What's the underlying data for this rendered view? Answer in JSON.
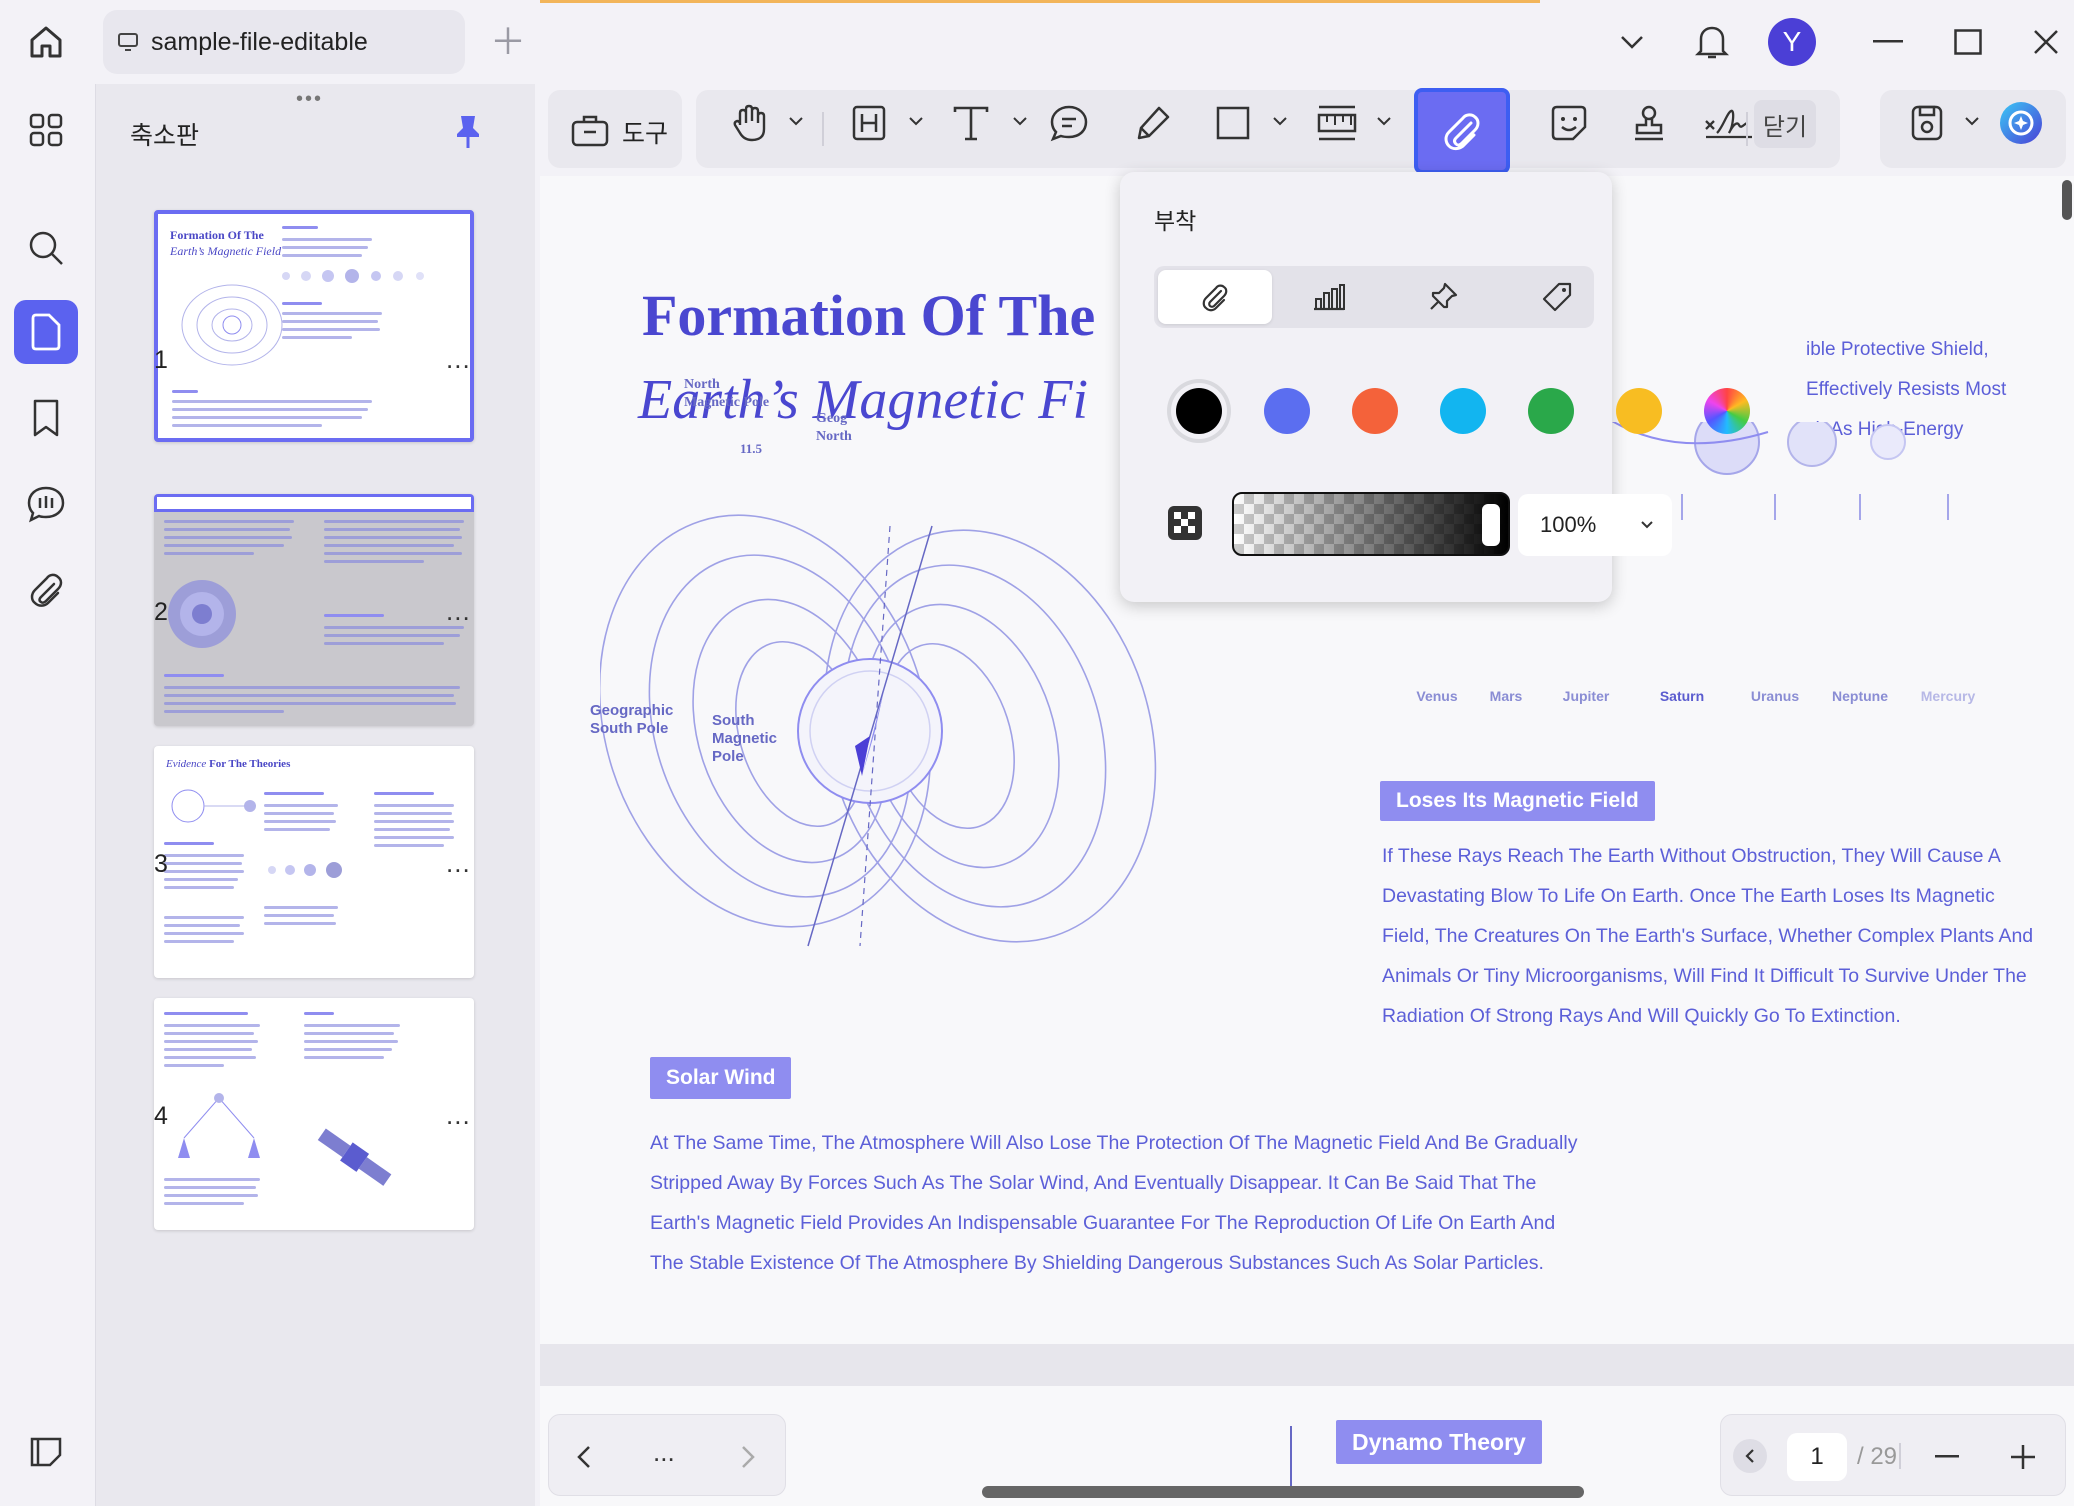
{
  "window": {
    "tab_title": "sample-file-editable",
    "avatar_letter": "Y",
    "accent_color": "#5b62ef"
  },
  "panel": {
    "title": "축소판",
    "pages": [
      {
        "number": "1",
        "more": "..."
      },
      {
        "number": "2",
        "more": "..."
      },
      {
        "number": "3",
        "more": "..."
      },
      {
        "number": "4",
        "more": "..."
      }
    ]
  },
  "toolbar": {
    "tools_label": "도구",
    "close_label": "닫기",
    "active_tool": "attachment"
  },
  "document": {
    "title_line1": "Formation Of The",
    "title_line2": "Earth’s Magnetic Fi",
    "right_lines": [
      "ible Protective Shield,",
      "Effectively Resists Most",
      "ch As High-Energy"
    ],
    "planets": [
      "Venus",
      "Mars",
      "Jupiter",
      "Saturn",
      "Uranus",
      "Neptune",
      "Mercury"
    ],
    "diagram": {
      "north_pole": "North\nMagnetic Pole",
      "geo_north": "Geog\nNorth",
      "angle": "11.5",
      "geo_south": "Geographic\nSouth Pole",
      "south_pole": "South\nMagnetic\nPole"
    },
    "section1_tag": "Loses Its Magnetic Field",
    "section1_lines": [
      "If These Rays Reach The Earth Without Obstruction, They Will Cause A",
      "Devastating Blow To Life On Earth. Once The Earth Loses Its Magnetic",
      "Field, The Creatures On The Earth's Surface, Whether Complex Plants And",
      "Animals Or Tiny Microorganisms, Will Find It Difficult To Survive Under The",
      "Radiation Of Strong Rays And Will Quickly Go To Extinction."
    ],
    "section2_tag": "Solar Wind",
    "section2_lines": [
      "At The Same Time, The Atmosphere Will Also Lose The Protection Of The Magnetic Field And Be Gradually",
      "Stripped Away By Forces Such As The Solar Wind, And Eventually Disappear. It Can Be Said That The",
      "Earth's Magnetic Field Provides An Indispensable Guarantee For The Reproduction Of Life On Earth And",
      "The Stable Existence Of The Atmosphere By Shielding Dangerous Substances Such As Solar Particles."
    ],
    "next_page_tag": "Dynamo Theory"
  },
  "popover": {
    "title": "부착",
    "tabs": [
      "attachment-clip",
      "graph",
      "pushpin",
      "tag"
    ],
    "colors": [
      "#000000",
      "#5b6ef0",
      "#f4623a",
      "#12b5f0",
      "#2aa84a",
      "#f8bd22",
      "rainbow"
    ],
    "selected_color": "#000000",
    "opacity": "100%"
  },
  "pager": {
    "more": "...",
    "current_page": "1",
    "total": "/ 29"
  }
}
